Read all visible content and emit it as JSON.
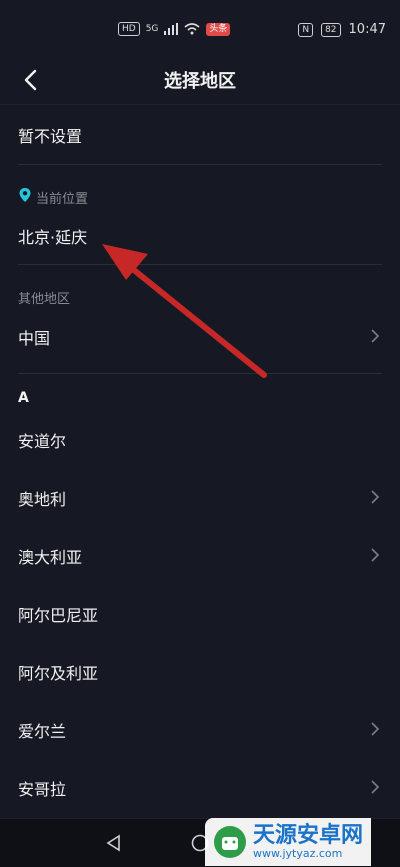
{
  "status": {
    "hd": "HD",
    "network": "5G",
    "app_badge": "头条",
    "battery": "82",
    "time": "10:47",
    "nfc": "N"
  },
  "header": {
    "title": "选择地区"
  },
  "no_setting": "暂不设置",
  "current_location": {
    "label": "当前位置",
    "value": "北京·延庆"
  },
  "other_regions": {
    "label": "其他地区",
    "china": "中国"
  },
  "alpha_index": "A",
  "countries": [
    {
      "name": "安道尔"
    },
    {
      "name": "奥地利"
    },
    {
      "name": "澳大利亚"
    },
    {
      "name": "阿尔巴尼亚"
    },
    {
      "name": "阿尔及利亚"
    },
    {
      "name": "爱尔兰"
    },
    {
      "name": "安哥拉"
    }
  ],
  "watermark": {
    "title": "天源安卓网",
    "url": "www.jytyaz.com"
  },
  "colors": {
    "accent_pin": "#26c6da",
    "arrow": "#c62828",
    "bg": "#161823"
  }
}
